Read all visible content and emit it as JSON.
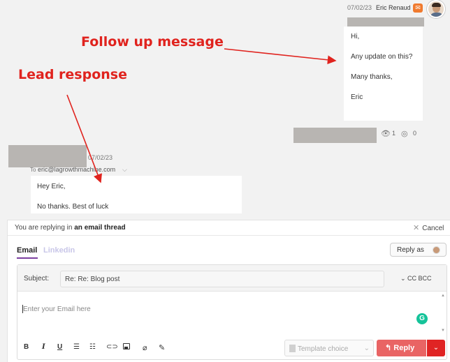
{
  "outgoing": {
    "date": "07/02/23",
    "sender": "Eric Renaud",
    "channel_icon": "mail-icon",
    "lines": [
      "Hi,",
      "Any update on this?",
      "Many thanks,",
      "Eric"
    ],
    "stats": {
      "opens": "1",
      "clicks": "0"
    }
  },
  "incoming": {
    "date": "07/02/23",
    "to_prefix": "To",
    "email": "eric@lagrowthmachine.com",
    "lines": [
      "Hey Eric,",
      "No thanks. Best of luck"
    ]
  },
  "annotations": {
    "follow_up": "Follow up message",
    "lead_response": "Lead response",
    "color": "#e0231e"
  },
  "reply": {
    "thread_prefix": "You are replying in",
    "thread_bold": "an email thread",
    "cancel": "Cancel",
    "tabs": [
      "Email",
      "Linkedin"
    ],
    "reply_as": "Reply as",
    "subject_label": "Subject:",
    "subject_value": "Re: Re: Blog post",
    "cc_bcc": "CC BCC",
    "placeholder": "Enter your Email here",
    "template_placeholder": "Template choice",
    "reply_button": "Reply",
    "accent": "#e96464"
  }
}
